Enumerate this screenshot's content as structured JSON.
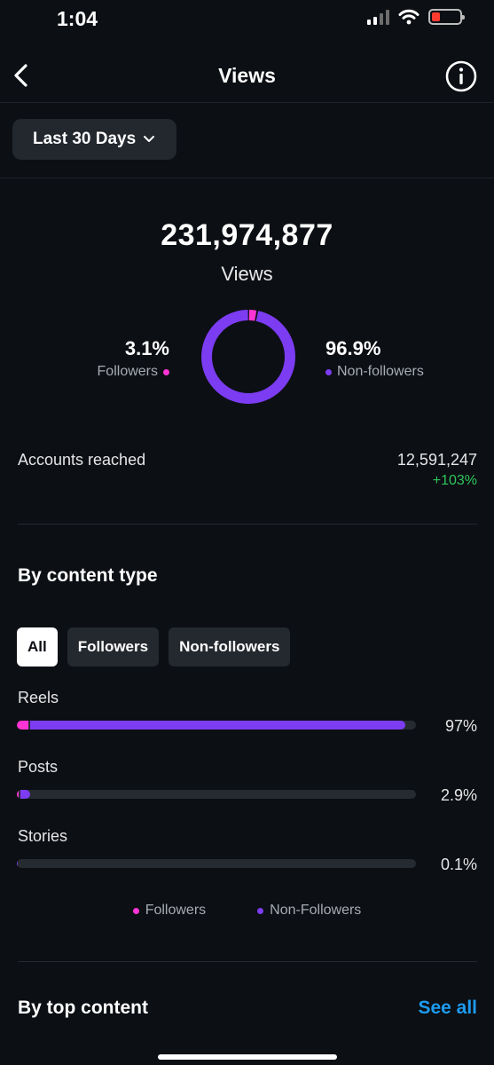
{
  "status_bar": {
    "time": "1:04"
  },
  "header": {
    "title": "Views"
  },
  "range_selector": {
    "label": "Last 30 Days"
  },
  "summary": {
    "total_views": "231,974,877",
    "views_label": "Views",
    "followers_pct": "3.1%",
    "followers_label": "Followers",
    "non_followers_pct": "96.9%",
    "non_followers_label": "Non-followers",
    "followers_share": 0.031,
    "non_followers_share": 0.969
  },
  "accounts_reached": {
    "label": "Accounts reached",
    "value": "12,591,247",
    "change": "+103%"
  },
  "by_content_type": {
    "title": "By content type",
    "filters": [
      "All",
      "Followers",
      "Non-followers"
    ],
    "active_filter": "All",
    "rows": [
      {
        "label": "Reels",
        "pct": "97%",
        "followers_share": 0.029,
        "non_followers_share": 0.941
      },
      {
        "label": "Posts",
        "pct": "2.9%",
        "followers_share": 0.004,
        "non_followers_share": 0.025
      },
      {
        "label": "Stories",
        "pct": "0.1%",
        "followers_share": 0.0,
        "non_followers_share": 0.001
      }
    ],
    "legend": {
      "followers": "Followers",
      "non_followers": "Non-Followers"
    }
  },
  "by_top_content": {
    "title": "By top content",
    "see_all": "See all"
  },
  "colors": {
    "followers": "#ff34d4",
    "non_followers": "#7c3cf2",
    "positive": "#2ec65a",
    "link": "#1d9bf0",
    "background": "#0c0f14"
  },
  "icons": [
    "back-chevron",
    "info-circle",
    "chevron-down",
    "cellular-signal",
    "wifi",
    "battery-low"
  ]
}
